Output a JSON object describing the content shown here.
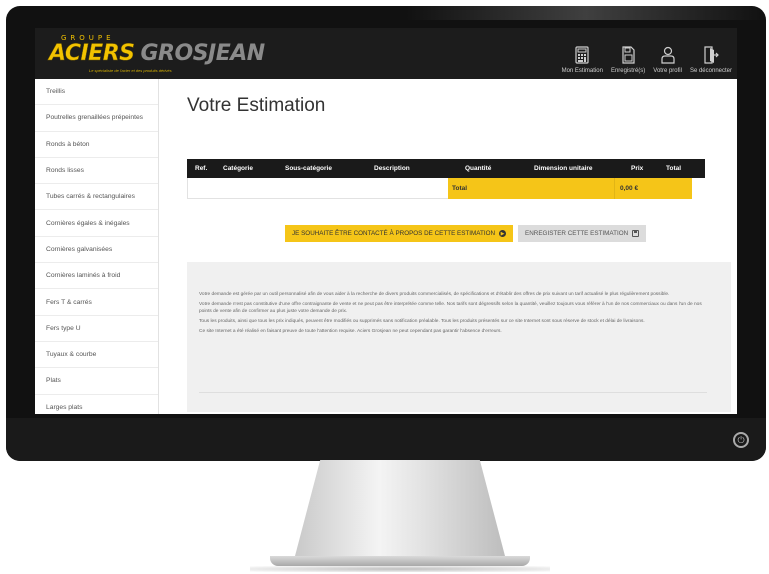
{
  "header": {
    "logo": {
      "groupe": "GROUPE",
      "aciers": "ACIERS",
      "grosjean": "GROSJEAN",
      "tagline": "Le spécialiste de l'acier et des produits dérivés"
    },
    "nav": [
      {
        "label": "Mon Estimation",
        "icon": "calculator-icon"
      },
      {
        "label": "Enregistré(s)",
        "icon": "saved-document-icon"
      },
      {
        "label": "Votre profil",
        "icon": "user-icon"
      },
      {
        "label": "Se déconnecter",
        "icon": "logout-icon"
      }
    ]
  },
  "sidebar": {
    "items": [
      {
        "label": "Treillis"
      },
      {
        "label": "Poutrelles grenaillées prépeintes"
      },
      {
        "label": "Ronds à béton"
      },
      {
        "label": "Ronds lisses"
      },
      {
        "label": "Tubes carrés & rectangulaires"
      },
      {
        "label": "Cornières égales & inégales"
      },
      {
        "label": "Cornières galvanisées"
      },
      {
        "label": "Cornières laminés à froid"
      },
      {
        "label": "Fers T & carrés"
      },
      {
        "label": "Fers type U"
      },
      {
        "label": "Tuyaux & courbe"
      },
      {
        "label": "Plats"
      },
      {
        "label": "Larges plats"
      }
    ]
  },
  "main": {
    "title": "Votre Estimation",
    "table": {
      "headers": {
        "ref": "Ref.",
        "categorie": "Catégorie",
        "sous_categorie": "Sous-catégorie",
        "description": "Description",
        "quantite": "Quantité",
        "dimension": "Dimension unitaire",
        "prix": "Prix",
        "total": "Total"
      },
      "total_label": "Total",
      "total_value": "0,00 €"
    },
    "actions": {
      "contact_label": "JE SOUHAITE ÊTRE CONTACTÉ À PROPOS DE CETTE ESTIMATION",
      "save_label": "ENREGISTER CETTE ESTIMATION"
    },
    "info": {
      "p1": "Votre demande est gérée par un outil personnalisé afin de vous aider à la recherche de divers produits commercialisés, de spécifications et d'établir des offres de prix suivant un tarif actualisé le plus régulièrement possible.",
      "p2": "Votre demande n'est pas constitutive d'une offre contraignante de vente et ne peut pas être interprétée comme telle. Nos tarifs sont dégressifs selon la quantité, veuillez toujours vous référer à l'un de nos commerciaux ou dans l'un de nos points de vente afin de confirmer au plus juste votre demande de prix.",
      "p3": "Tous les produits, ainsi que tous les prix indiqués, peuvent être modifiés ou supprimés sans notification préalable. Tous les produits présentés sur ce site Internet sont sous réserve de stock et délai de livraisons.",
      "p4": "Ce site Internet a été réalisé en faisant preuve de toute l'attention requise. Aciers Grosjean ne peut cependant pas garantir l'absence d'erreurs."
    }
  },
  "colors": {
    "brand_yellow": "#f5c518",
    "header_dark": "#1c1c1c",
    "button_grey": "#dcdcdc"
  }
}
